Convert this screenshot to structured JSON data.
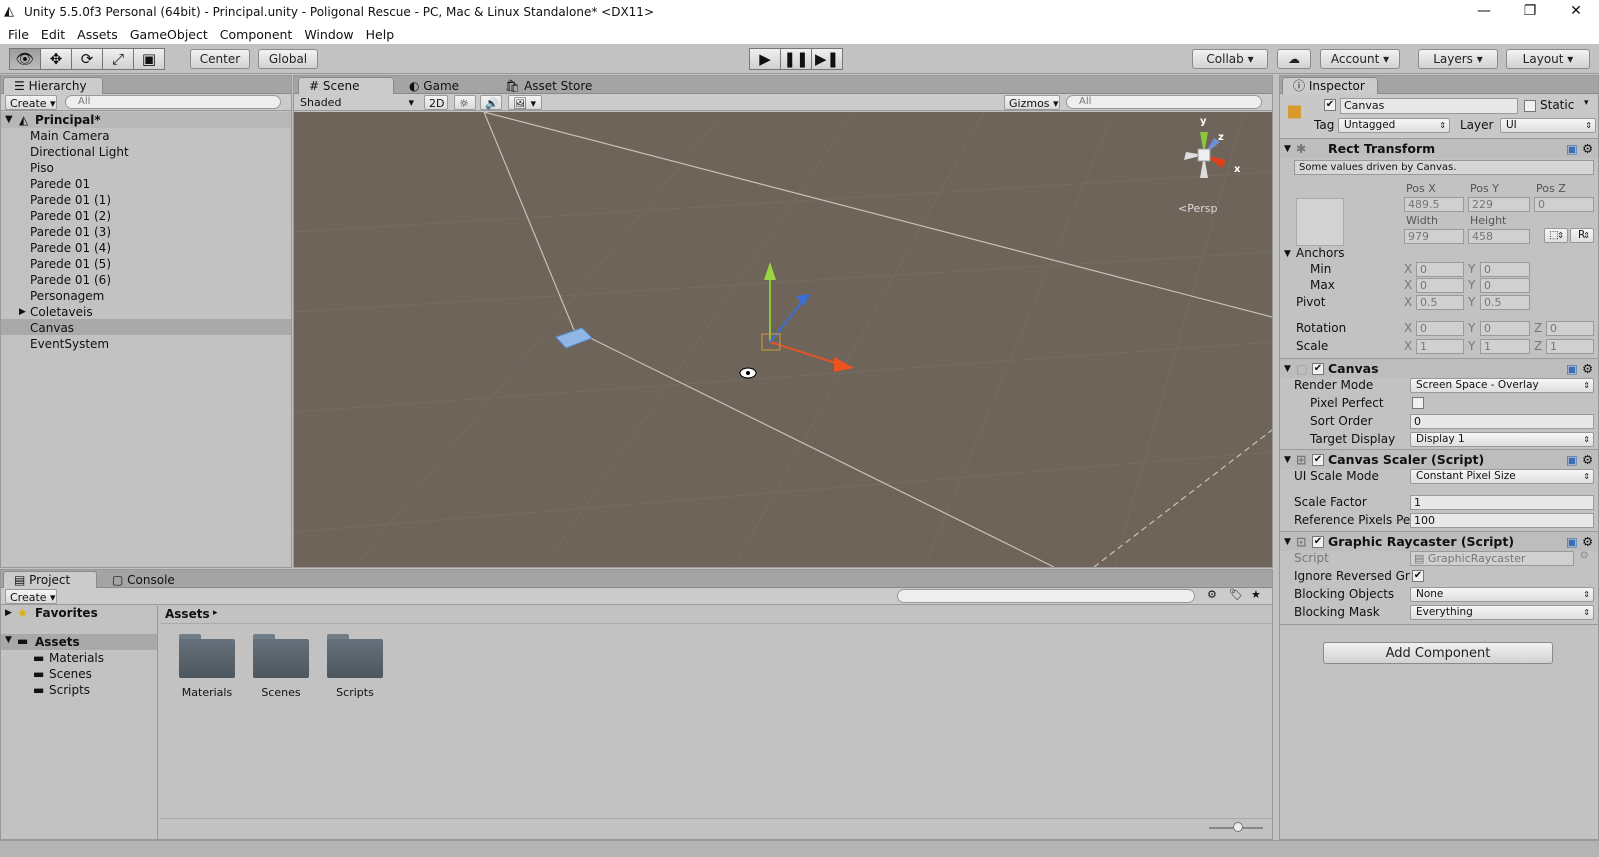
{
  "title": "Unity 5.5.0f3 Personal (64bit) - Principal.unity - Poligonal Rescue - PC, Mac & Linux Standalone* <DX11>",
  "window_controls": {
    "minimize": "—",
    "restore": "❐",
    "close": "✕"
  },
  "menu": [
    "File",
    "Edit",
    "Assets",
    "GameObject",
    "Component",
    "Window",
    "Help"
  ],
  "toolbar": {
    "pivot": "Center",
    "space": "Global",
    "collab": "Collab",
    "account": "Account",
    "layers": "Layers",
    "layout": "Layout"
  },
  "hierarchy": {
    "tab": "Hierarchy",
    "create": "Create",
    "search_placeholder": "All",
    "scene": "Principal*",
    "items": [
      "Main Camera",
      "Directional Light",
      "Piso",
      "Parede 01",
      "Parede 01 (1)",
      "Parede 01 (2)",
      "Parede 01 (3)",
      "Parede 01 (4)",
      "Parede 01 (5)",
      "Parede 01 (6)",
      "Personagem",
      "Coletaveis",
      "Canvas",
      "EventSystem"
    ],
    "selected": "Canvas"
  },
  "scene_view": {
    "tabs": [
      "Scene",
      "Game",
      "Asset Store"
    ],
    "shading": "Shaded",
    "mode2d": "2D",
    "gizmos": "Gizmos",
    "search_placeholder": "All",
    "persp": "Persp",
    "axis_y": "y",
    "axis_z": "z",
    "axis_x": "x"
  },
  "inspector": {
    "tab": "Inspector",
    "name": "Canvas",
    "static": "Static",
    "tag_label": "Tag",
    "tag": "Untagged",
    "layer_label": "Layer",
    "layer": "UI",
    "rect": {
      "title": "Rect Transform",
      "note": "Some values driven by Canvas.",
      "posx_l": "Pos X",
      "posy_l": "Pos Y",
      "posz_l": "Pos Z",
      "posx": "489.5",
      "posy": "229",
      "posz": "0",
      "width_l": "Width",
      "height_l": "Height",
      "width": "979",
      "height": "458",
      "r": "R",
      "anchors": "Anchors",
      "min": "Min",
      "max": "Max",
      "pivot": "Pivot",
      "rotation": "Rotation",
      "scale": "Scale",
      "x": "X",
      "y": "Y",
      "z": "Z",
      "min_x": "0",
      "min_y": "0",
      "max_x": "0",
      "max_y": "0",
      "pivot_x": "0.5",
      "pivot_y": "0.5",
      "rot_x": "0",
      "rot_y": "0",
      "rot_z": "0",
      "scale_x": "1",
      "scale_y": "1",
      "scale_z": "1"
    },
    "canvas": {
      "title": "Canvas",
      "render_mode_l": "Render Mode",
      "render_mode": "Screen Space - Overlay",
      "pixel_perfect_l": "Pixel Perfect",
      "sort_order_l": "Sort Order",
      "sort_order": "0",
      "target_display_l": "Target Display",
      "target_display": "Display 1"
    },
    "scaler": {
      "title": "Canvas Scaler (Script)",
      "ui_scale_l": "UI Scale Mode",
      "ui_scale": "Constant Pixel Size",
      "scale_factor_l": "Scale Factor",
      "scale_factor": "1",
      "ref_ppu_l": "Reference Pixels Per",
      "ref_ppu": "100"
    },
    "raycaster": {
      "title": "Graphic Raycaster (Script)",
      "script_l": "Script",
      "script": "GraphicRaycaster",
      "ignore_l": "Ignore Reversed Gra",
      "blocking_objects_l": "Blocking Objects",
      "blocking_objects": "None",
      "blocking_mask_l": "Blocking Mask",
      "blocking_mask": "Everything"
    },
    "add_component": "Add Component"
  },
  "project": {
    "tabs": [
      "Project",
      "Console"
    ],
    "create": "Create",
    "favorites": "Favorites",
    "assets": "Assets",
    "tree": [
      "Materials",
      "Scenes",
      "Scripts"
    ],
    "breadcrumb": "Assets",
    "folders": [
      "Materials",
      "Scenes",
      "Scripts"
    ]
  }
}
